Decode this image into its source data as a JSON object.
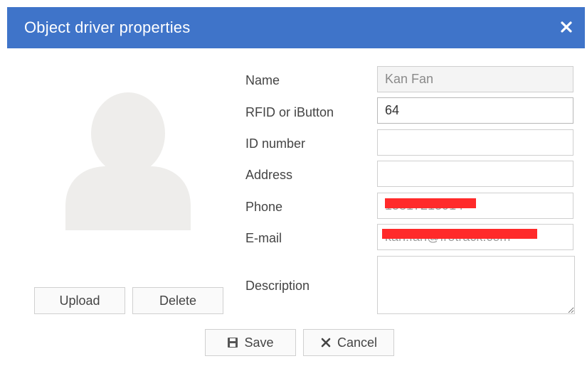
{
  "dialog": {
    "title": "Object driver properties",
    "close_icon": "close-icon",
    "accent_color": "#3f74c9"
  },
  "avatar": {
    "icon": "user-placeholder-icon",
    "upload_label": "Upload",
    "delete_label": "Delete"
  },
  "form": {
    "name": {
      "label": "Name",
      "value": "Kan Fan"
    },
    "rfid": {
      "label": "RFID or iButton",
      "value": "64"
    },
    "id_number": {
      "label": "ID number",
      "value": ""
    },
    "address": {
      "label": "Address",
      "value": ""
    },
    "phone": {
      "label": "Phone",
      "value": "15817215914"
    },
    "email": {
      "label": "E-mail",
      "value": "kan.fan@frotrack.com"
    },
    "description": {
      "label": "Description",
      "value": ""
    }
  },
  "actions": {
    "save_label": "Save",
    "save_icon": "floppy-disk-icon",
    "cancel_label": "Cancel",
    "cancel_icon": "x-icon"
  }
}
